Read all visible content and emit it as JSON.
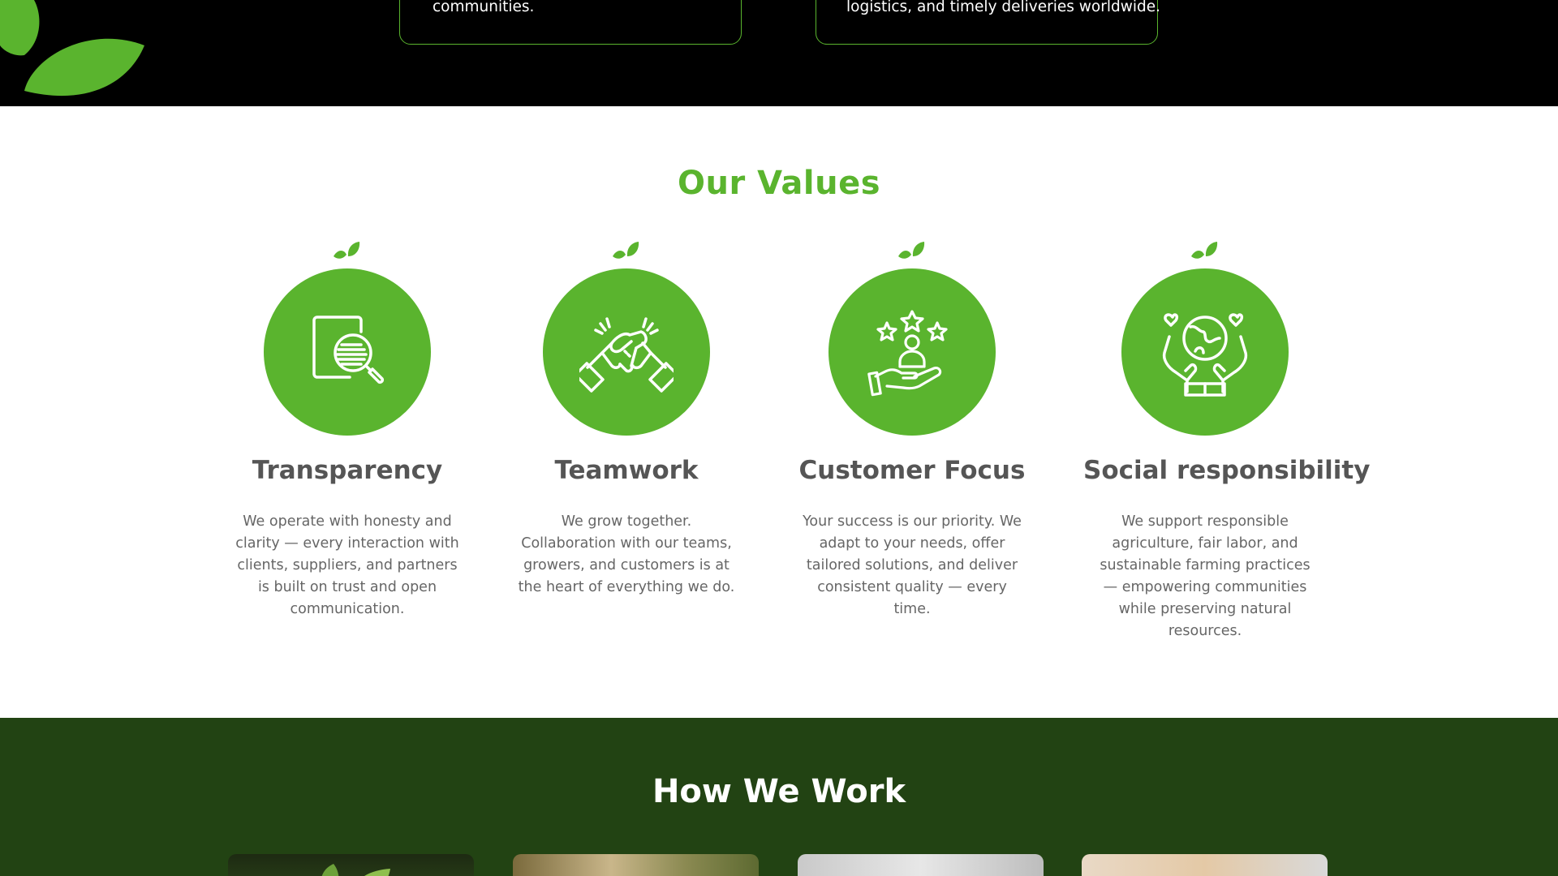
{
  "brand": {
    "accent": "#5ab42e",
    "dark_green": "#224313"
  },
  "top_cards": [
    {
      "text": "communities."
    },
    {
      "text": "logistics, and timely deliveries worldwide."
    }
  ],
  "values": {
    "title": "Our Values",
    "items": [
      {
        "icon": "document-search-icon",
        "title": "Transparency",
        "desc": "We operate with honesty and clarity — every interaction with clients, suppliers, and partners is built on trust and open communication."
      },
      {
        "icon": "handshake-icon",
        "title": "Teamwork",
        "desc": "We grow together. Collaboration with our teams, growers, and customers is at the heart of everything we do."
      },
      {
        "icon": "customer-stars-icon",
        "title": "Customer Focus",
        "desc": "Your success is our priority. We adapt to your needs, offer tailored solutions, and deliver consistent quality — every time."
      },
      {
        "icon": "hands-globe-icon",
        "title": "Social responsibility",
        "desc": "We support responsible agriculture, fair labor, and sustainable farming practices — empowering communities while preserving natural resources."
      }
    ]
  },
  "how": {
    "title": "How We Work",
    "cards": [
      {
        "image": "seedling-photo"
      },
      {
        "image": "farm-worker-photo"
      },
      {
        "image": "warehouse-photo"
      },
      {
        "image": "packaging-photo"
      }
    ]
  }
}
